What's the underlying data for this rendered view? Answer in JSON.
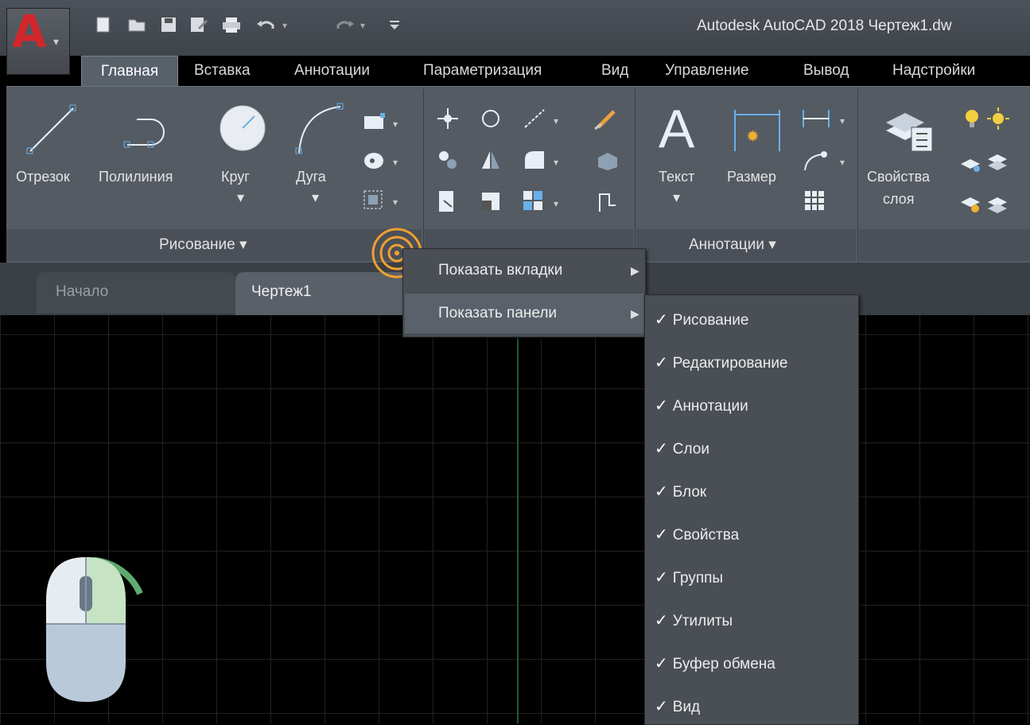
{
  "titlebar": {
    "app_letter": "A",
    "title": "Autodesk AutoCAD 2018    Чертеж1.dw"
  },
  "ribbon_tabs": [
    "Главная",
    "Вставка",
    "Аннотации",
    "Параметризация",
    "Вид",
    "Управление",
    "Вывод",
    "Надстройки"
  ],
  "draw_panel": {
    "tools": [
      "Отрезок",
      "Полилиния",
      "Круг",
      "Дуга"
    ],
    "title": "Рисование"
  },
  "annotation_panel": {
    "tools": [
      "Текст",
      "Размер"
    ],
    "title": "Аннотации"
  },
  "layers_panel": {
    "tool_line1": "Свойства",
    "tool_line2": "слоя"
  },
  "file_tabs": [
    "Начало",
    "Чертеж1"
  ],
  "context_menu": {
    "items": [
      "Показать вкладки",
      "Показать панели"
    ]
  },
  "panels_submenu": {
    "check_symbol": "✓",
    "items": [
      "Рисование",
      "Редактирование",
      "Аннотации",
      "Слои",
      "Блок",
      "Свойства",
      "Группы",
      "Утилиты",
      "Буфер обмена",
      "Вид"
    ]
  },
  "colors": {
    "accent_red": "#d2262c",
    "cursor_ring": "#f0a030",
    "ribbon_bg": "#555b63"
  },
  "icons": [
    "undo-icon",
    "redo-icon",
    "save-icon",
    "open-icon",
    "new-icon",
    "print-icon",
    "mouse-right-click-icon"
  ]
}
